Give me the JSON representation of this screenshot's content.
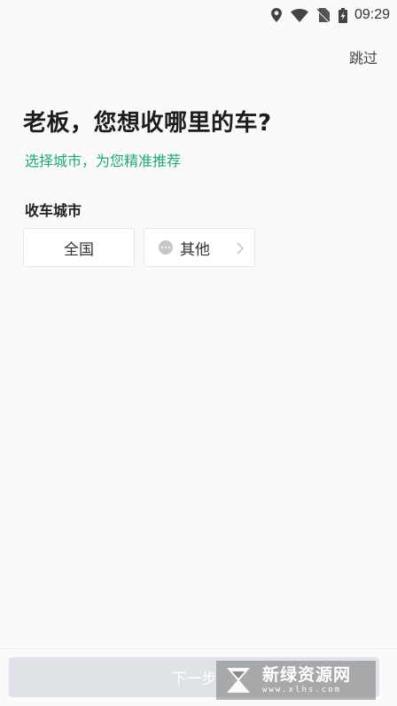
{
  "status_bar": {
    "time": "09:29",
    "icons": [
      "location-icon",
      "wifi-icon",
      "no-sim-icon",
      "battery-charging-icon"
    ]
  },
  "header": {
    "skip_label": "跳过"
  },
  "main": {
    "headline": "老板，您想收哪里的车?",
    "subtitle": "选择城市，为您精准推荐",
    "section_label": "收车城市",
    "chips": {
      "all_label": "全国",
      "other_label": "其他"
    }
  },
  "footer": {
    "next_label": "下一步"
  },
  "watermark": {
    "title": "新绿资源网",
    "url": "www.xlhs.com"
  },
  "colors": {
    "accent": "#1fa971",
    "background": "#fafafa",
    "button_disabled": "#dfe2e6"
  }
}
